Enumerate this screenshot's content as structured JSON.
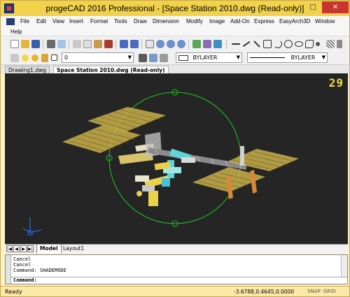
{
  "window": {
    "title": "progeCAD 2016 Professional - [Space Station 2010.dwg (Read-only)]",
    "minimize_symbol": "–",
    "maximize_symbol": "□",
    "close_symbol": "✕"
  },
  "menu": {
    "items": [
      "File",
      "Edit",
      "View",
      "Insert",
      "Format",
      "Tools",
      "Draw",
      "Dimension",
      "Modify",
      "Image",
      "Add-On",
      "Express",
      "EasyArch3D",
      "Window",
      "Help"
    ]
  },
  "toolbar": {
    "layer_value": "0",
    "color_value": "BYLAYER",
    "linetype_value": "BYLAYER"
  },
  "tabs": {
    "documents": [
      {
        "label": "Drawing1.dwg",
        "active": false
      },
      {
        "label": "Space Station 2010.dwg (Read-only)",
        "active": true
      }
    ]
  },
  "viewport": {
    "frame_counter": "29",
    "orbit_color": "#1ec81e",
    "background": "#252525"
  },
  "layout": {
    "nav_buttons": [
      "|◀",
      "◀",
      "▶",
      "▶|"
    ],
    "tabs": [
      {
        "label": "Model",
        "active": true
      },
      {
        "label": "Layout1",
        "active": false
      }
    ]
  },
  "command": {
    "history": [
      "Cancel",
      "Cancel",
      "Command: SHADEMODE"
    ],
    "prompt": "Command:"
  },
  "status": {
    "text": "Ready",
    "coordinates": "-3.6788,0.4645,0.0000",
    "toggles": [
      "SNAP",
      "GRID"
    ]
  },
  "colors": {
    "title_bar": "#f2d24a",
    "solar_panel": "#c9b04a",
    "module_cyan": "#5ed4d8",
    "module_yellow": "#e9d24a"
  }
}
